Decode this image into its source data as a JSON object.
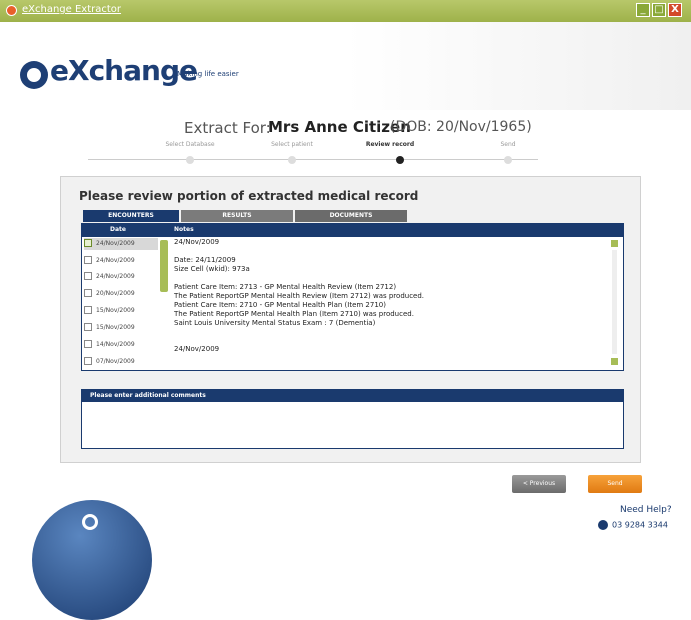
{
  "window": {
    "title": "eXchange Extractor",
    "minimize_label": "_",
    "maximize_label": "□",
    "close_label": "X"
  },
  "header": {
    "logo_text": "eXchange",
    "tagline": "Making life easier"
  },
  "extract": {
    "label": "Extract For:",
    "patient_name": "Mrs Anne Citizen",
    "dob": "(DOB: 20/Nov/1965)"
  },
  "steps": [
    {
      "label": "Select Database",
      "active": false
    },
    {
      "label": "Select patient",
      "active": false
    },
    {
      "label": "Review record",
      "active": true
    },
    {
      "label": "Send",
      "active": false
    }
  ],
  "panel": {
    "title": "Please review portion of extracted medical record",
    "tabs": [
      "ENCOUNTERS",
      "RESULTS",
      "DOCUMENTS"
    ],
    "columns": {
      "date": "Date",
      "notes": "Notes"
    },
    "dates": [
      "24/Nov/2009",
      "24/Nov/2009",
      "24/Nov/2009",
      "20/Nov/2009",
      "15/Nov/2009",
      "15/Nov/2009",
      "14/Nov/2009",
      "07/Nov/2009"
    ],
    "notes": [
      "24/Nov/2009",
      "",
      "Date: 24/11/2009",
      "Size Cell (wkid): 973a",
      "",
      "Patient Care Item: 2713 - GP Mental Health Review (Item 2712)",
      "The Patient ReportGP Mental Health Review (Item 2712) was produced.",
      "Patient Care Item: 2710 - GP Mental Health Plan (Item 2710)",
      "The Patient ReportGP Mental Health Plan (Item 2710) was produced.",
      "Saint Louis University Mental Status Exam : 7 (Dementia)",
      "",
      "24/Nov/2009"
    ],
    "comment_label": "Please enter additional comments"
  },
  "buttons": {
    "previous": "< Previous",
    "send": "Send"
  },
  "help": {
    "title": "Need Help?",
    "phone": "03 9284 3344"
  }
}
